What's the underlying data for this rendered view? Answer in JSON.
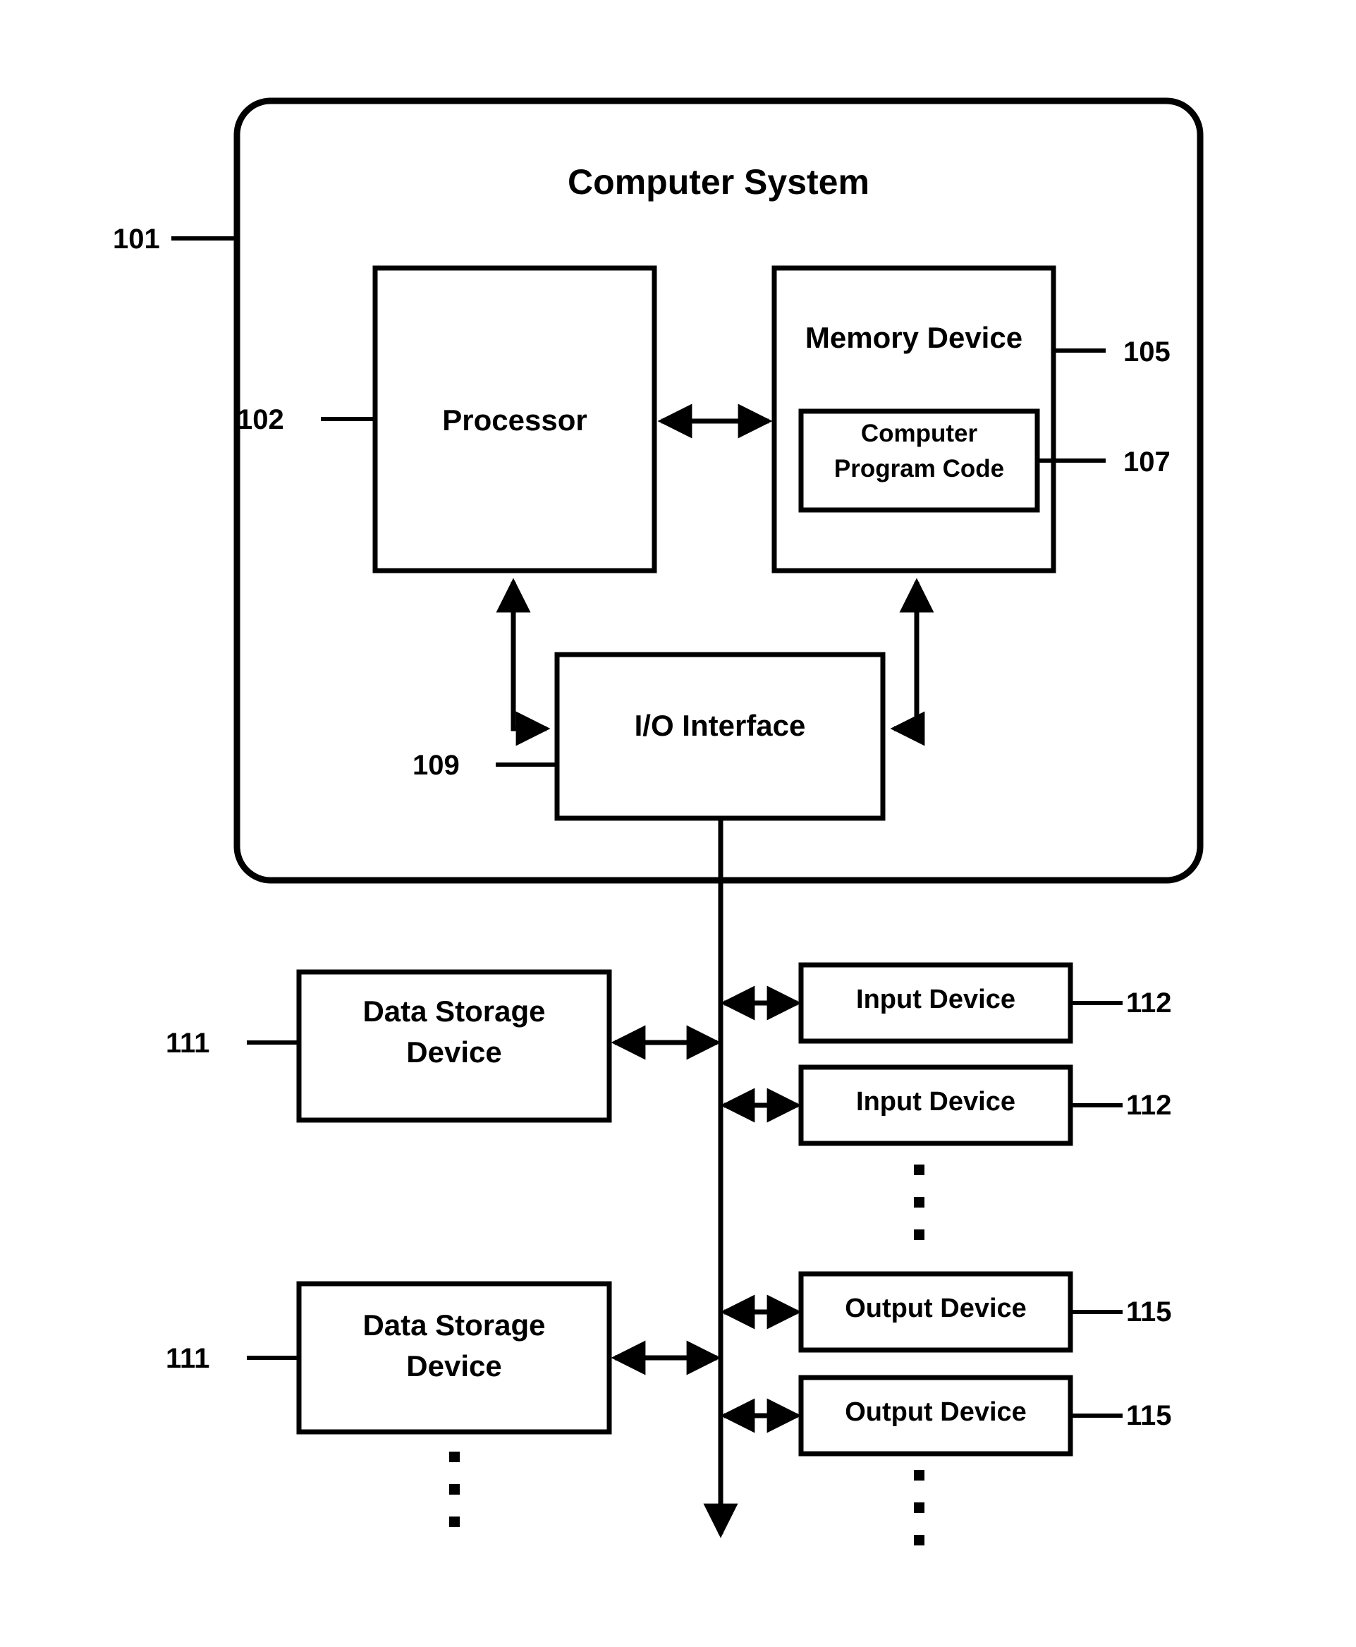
{
  "figure": {
    "type": "block-diagram",
    "title": "Computer System",
    "background_color": "#ffffff",
    "line_color": "#000000"
  },
  "outer_system": {
    "label": "Computer System",
    "ref": "101",
    "shape": "rounded-rectangle"
  },
  "blocks": {
    "processor": {
      "label": "Processor",
      "ref": "102"
    },
    "memory_device": {
      "label": "Memory Device",
      "ref": "105"
    },
    "computer_program_code": {
      "label_line1": "Computer",
      "label_line2": "Program Code",
      "ref": "107"
    },
    "io_interface": {
      "label": "I/O Interface",
      "ref": "109"
    },
    "data_storage_1": {
      "label_line1": "Data Storage",
      "label_line2": "Device",
      "ref": "111"
    },
    "data_storage_2": {
      "label_line1": "Data Storage",
      "label_line2": "Device",
      "ref": "111"
    },
    "input_device_1": {
      "label": "Input Device",
      "ref": "112"
    },
    "input_device_2": {
      "label": "Input Device",
      "ref": "112"
    },
    "output_device_1": {
      "label": "Output Device",
      "ref": "115"
    },
    "output_device_2": {
      "label": "Output Device",
      "ref": "115"
    }
  },
  "ellipses": [
    {
      "name": "input-devices-ellipsis",
      "dots": 3
    },
    {
      "name": "output-devices-ellipsis",
      "dots": 3
    },
    {
      "name": "data-storage-ellipsis",
      "dots": 3
    }
  ],
  "connectors": [
    {
      "from": "processor",
      "to": "memory_device",
      "style": "double-arrow"
    },
    {
      "from": "processor",
      "to": "io_interface",
      "style": "double-arrow-elbow"
    },
    {
      "from": "memory_device",
      "to": "io_interface",
      "style": "double-arrow-elbow"
    },
    {
      "from": "io_interface",
      "to": "bus",
      "style": "line-down-arrow"
    },
    {
      "from": "data_storage_1",
      "to": "bus",
      "style": "double-arrow"
    },
    {
      "from": "data_storage_2",
      "to": "bus",
      "style": "double-arrow"
    },
    {
      "from": "bus",
      "to": "input_device_1",
      "style": "double-arrow"
    },
    {
      "from": "bus",
      "to": "input_device_2",
      "style": "double-arrow"
    },
    {
      "from": "bus",
      "to": "output_device_1",
      "style": "double-arrow"
    },
    {
      "from": "bus",
      "to": "output_device_2",
      "style": "double-arrow"
    }
  ]
}
